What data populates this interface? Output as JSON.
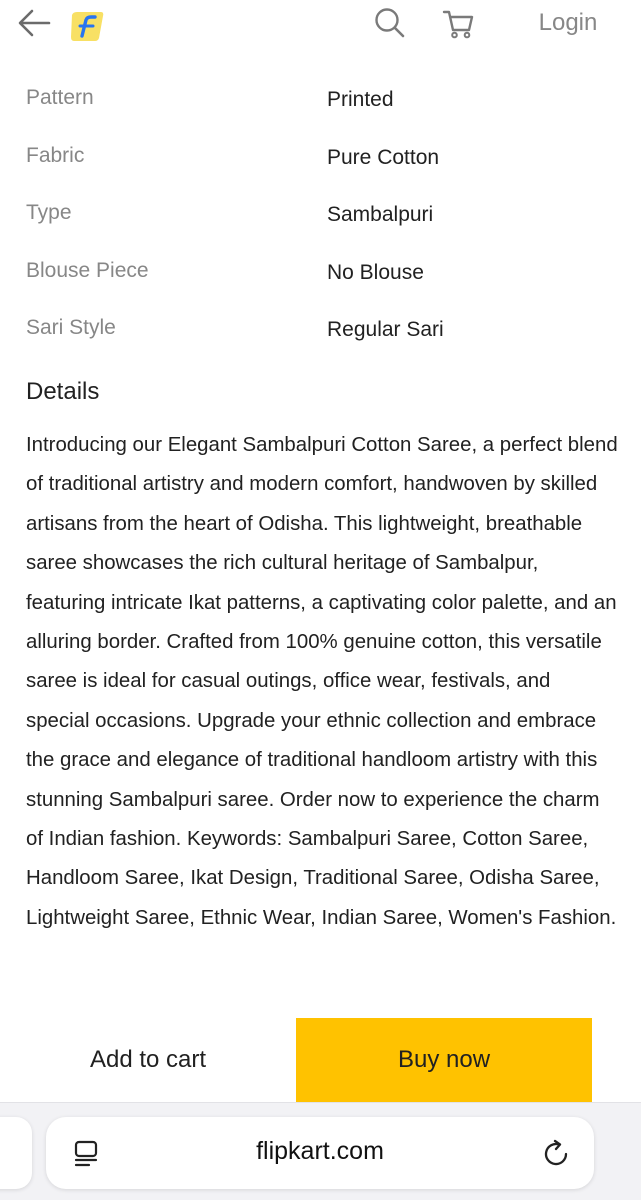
{
  "header": {
    "back_icon": "arrow-left-icon",
    "logo_icon": "flipkart-logo",
    "search_icon": "search-icon",
    "cart_icon": "cart-icon",
    "login_label": "Login"
  },
  "specifications": [
    {
      "key": "Pattern",
      "value": "Printed"
    },
    {
      "key": "Fabric",
      "value": "Pure Cotton"
    },
    {
      "key": "Type",
      "value": "Sambalpuri"
    },
    {
      "key": "Blouse Piece",
      "value": "No Blouse"
    },
    {
      "key": "Sari Style",
      "value": "Regular Sari"
    }
  ],
  "details": {
    "heading": "Details",
    "text": "Introducing our Elegant Sambalpuri Cotton Saree, a perfect blend of traditional artistry and modern comfort, handwoven by skilled artisans from the heart of Odisha. This lightweight, breathable saree showcases the rich cultural heritage of Sambalpur, featuring intricate Ikat patterns, a captivating color palette, and an alluring border. Crafted from 100% genuine cotton, this versatile saree is ideal for casual outings, office wear, festivals, and special occasions. Upgrade your ethnic collection and embrace the grace and elegance of traditional handloom artistry with this stunning Sambalpuri saree. Order now to experience the charm of Indian fashion. Keywords: Sambalpuri Saree, Cotton Saree, Handloom Saree, Ikat Design, Traditional Saree, Odisha Saree, Lightweight Saree, Ethnic Wear, Indian Saree, Women's Fashion."
  },
  "actions": {
    "add_to_cart": "Add to cart",
    "buy_now": "Buy now"
  },
  "browser": {
    "url": "flipkart.com",
    "reader_icon": "reader-mode-icon",
    "reload_icon": "reload-icon"
  },
  "colors": {
    "buy_now_bg": "#ffc200",
    "label_gray": "#878787",
    "text_dark": "#212121"
  }
}
